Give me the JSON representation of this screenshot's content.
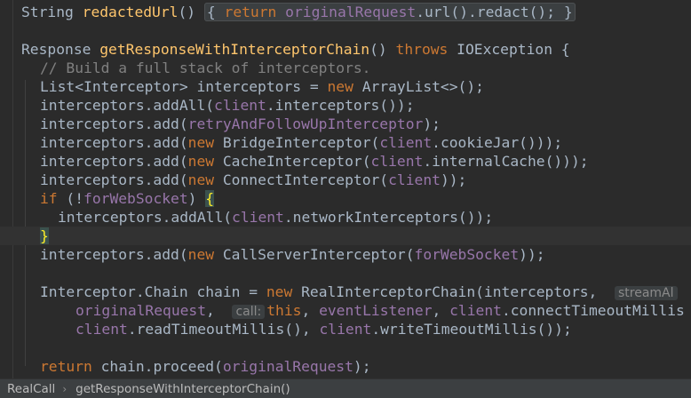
{
  "editor": {
    "redacted_method": {
      "type": "String",
      "name": "redactedUrl",
      "parens": "()",
      "fold_open": "{",
      "ret": "return",
      "body": "originalRequest",
      "rest": ".url().redact();",
      "fold_close": "}"
    },
    "signature": {
      "type": "Response",
      "name": "getResponseWithInterceptorChain",
      "parens": "()",
      "throws": "throws",
      "exc": "IOException {"
    },
    "comment": "// Build a full stack of interceptors.",
    "l1": {
      "a": "List<Interceptor> interceptors = ",
      "kw": "new",
      "b": " ArrayList<>();"
    },
    "l2": {
      "a": "interceptors.addAll(",
      "f": "client",
      "b": ".interceptors());"
    },
    "l3": {
      "a": "interceptors.add(",
      "f": "retryAndFollowUpInterceptor",
      "b": ");"
    },
    "l4": {
      "a": "interceptors.add(",
      "kw": "new",
      "b": " BridgeInterceptor(",
      "f": "client",
      "c": ".cookieJar()));"
    },
    "l5": {
      "a": "interceptors.add(",
      "kw": "new",
      "b": " CacheInterceptor(",
      "f": "client",
      "c": ".internalCache()));"
    },
    "l6": {
      "a": "interceptors.add(",
      "kw": "new",
      "b": " ConnectInterceptor(",
      "f": "client",
      "c": "));"
    },
    "l7": {
      "kw": "if",
      "a": " (!",
      "f": "forWebSocket",
      "b": ") ",
      "brace": "{"
    },
    "l8": {
      "a": "interceptors.addAll(",
      "f": "client",
      "b": ".networkInterceptors());"
    },
    "l9": {
      "brace": "}"
    },
    "l10": {
      "a": "interceptors.add(",
      "kw": "new",
      "b": " CallServerInterceptor(",
      "f": "forWebSocket",
      "c": "));"
    },
    "l11": {
      "a": "Interceptor.Chain chain = ",
      "kw": "new",
      "b": " RealInterceptorChain(interceptors, ",
      "hint": "streamAl"
    },
    "l12": {
      "f": "originalRequest",
      "a": ", ",
      "hint": "call:",
      "kw": "this",
      "b": ", ",
      "f2": "eventListener",
      "c": ", ",
      "f3": "client",
      "d": ".connectTimeoutMillis"
    },
    "l13": {
      "f": "client",
      "a": ".readTimeoutMillis(), ",
      "f2": "client",
      "b": ".writeTimeoutMillis());"
    },
    "l14": {
      "kw": "return",
      "a": " chain.proceed(",
      "f": "originalRequest",
      "b": ");"
    }
  },
  "colors": {
    "background": "#2b2b2b",
    "keyword": "#cc7832",
    "method": "#ffc66d",
    "field": "#9876aa",
    "comment": "#808080",
    "text": "#a9b7c6"
  },
  "breadcrumb": {
    "class_name": "RealCall",
    "separator": "›",
    "method_name": "getResponseWithInterceptorChain()"
  }
}
